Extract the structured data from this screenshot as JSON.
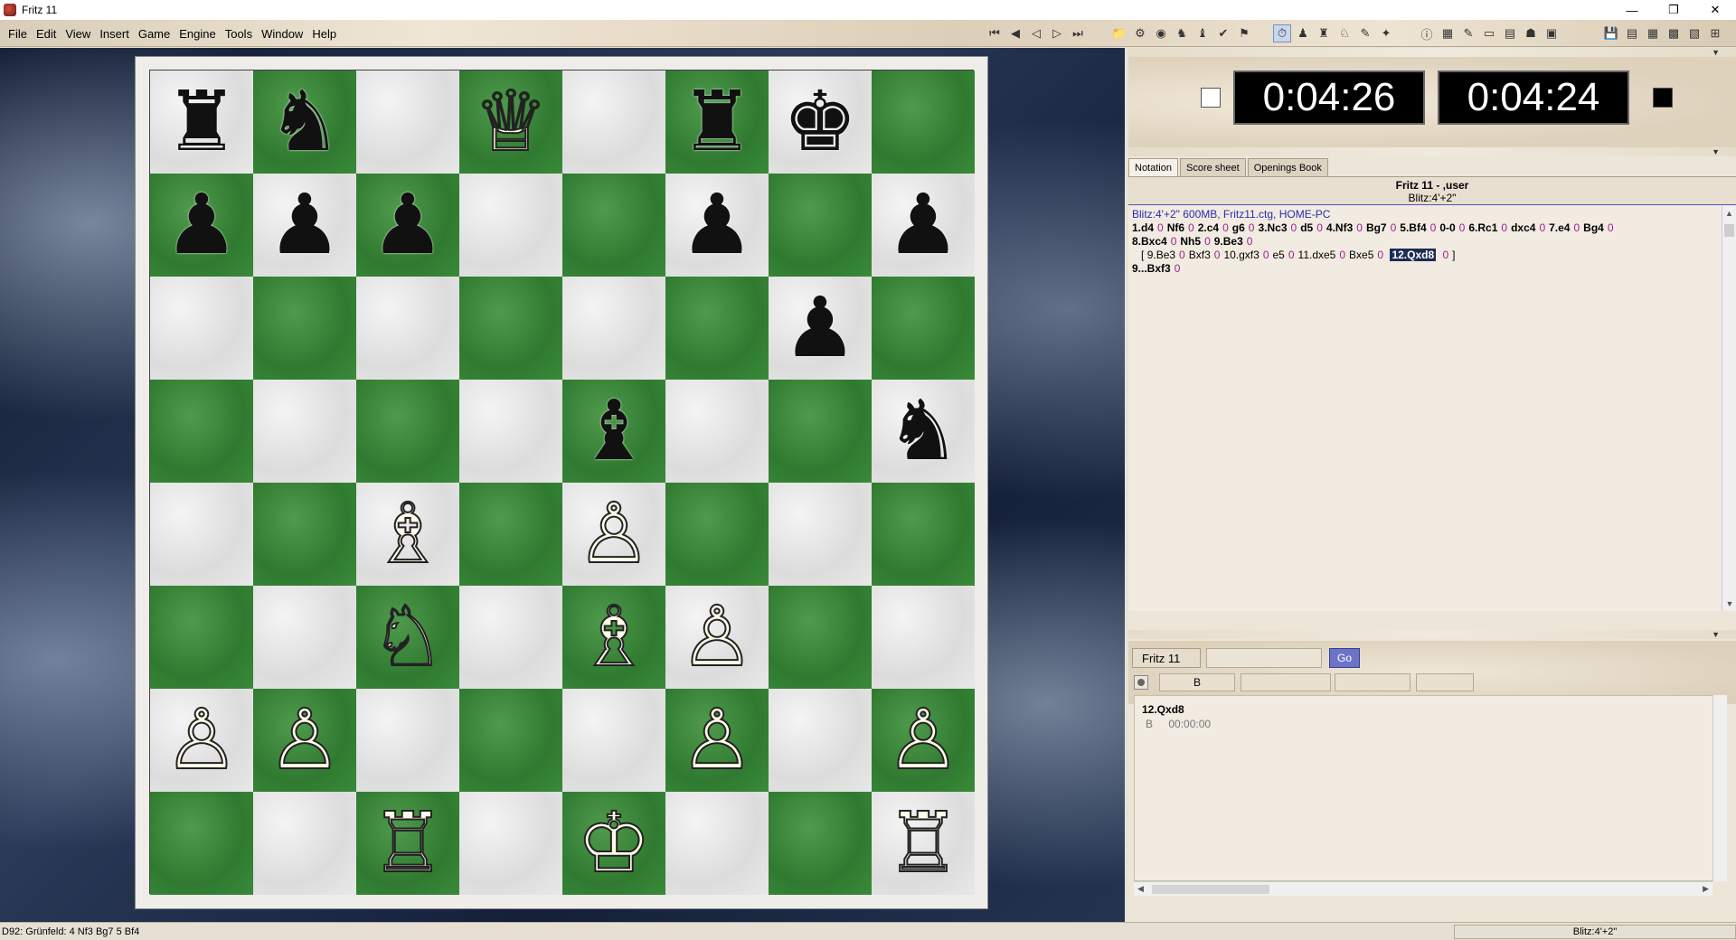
{
  "window": {
    "title": "Fritz 11",
    "minimize": "—",
    "restore": "❐",
    "close": "✕"
  },
  "menu": [
    "File",
    "Edit",
    "View",
    "Insert",
    "Game",
    "Engine",
    "Tools",
    "Window",
    "Help"
  ],
  "toolbar": {
    "nav": [
      "⏮",
      "◀",
      "◁",
      "▷",
      "⏭"
    ],
    "group2": [
      "📁",
      "⚙",
      "◉",
      "♞",
      "♝",
      "✔",
      "⚑"
    ],
    "group3": [
      "⏱",
      "♟",
      "♜",
      "♘",
      "✎",
      "✦"
    ],
    "group4": [
      "ⓘ",
      "▦",
      "✎",
      "▭",
      "▤",
      "☗",
      "▣"
    ],
    "group5": [
      "💾",
      "▤",
      "▦",
      "▩",
      "▧",
      "⊞"
    ]
  },
  "board": {
    "ranks": [
      [
        {
          "p": "♜",
          "c": "b"
        },
        {
          "p": "♞",
          "c": "b"
        },
        null,
        {
          "p": "♕",
          "c": "w"
        },
        null,
        {
          "p": "♜",
          "c": "b"
        },
        {
          "p": "♚",
          "c": "b"
        },
        null
      ],
      [
        {
          "p": "♟",
          "c": "b"
        },
        {
          "p": "♟",
          "c": "b"
        },
        {
          "p": "♟",
          "c": "b"
        },
        null,
        null,
        {
          "p": "♟",
          "c": "b"
        },
        null,
        {
          "p": "♟",
          "c": "b"
        }
      ],
      [
        null,
        null,
        null,
        null,
        null,
        null,
        {
          "p": "♟",
          "c": "b"
        },
        null
      ],
      [
        null,
        null,
        null,
        null,
        {
          "p": "♝",
          "c": "b"
        },
        null,
        null,
        {
          "p": "♞",
          "c": "b"
        }
      ],
      [
        null,
        null,
        {
          "p": "♗",
          "c": "w"
        },
        null,
        {
          "p": "♙",
          "c": "w"
        },
        null,
        null,
        null
      ],
      [
        null,
        null,
        {
          "p": "♘",
          "c": "w"
        },
        null,
        {
          "p": "♗",
          "c": "w"
        },
        {
          "p": "♙",
          "c": "w"
        },
        null,
        null
      ],
      [
        {
          "p": "♙",
          "c": "w"
        },
        {
          "p": "♙",
          "c": "w"
        },
        null,
        null,
        null,
        {
          "p": "♙",
          "c": "w"
        },
        null,
        {
          "p": "♙",
          "c": "w"
        }
      ],
      [
        null,
        null,
        {
          "p": "♖",
          "c": "w"
        },
        null,
        {
          "p": "♔",
          "c": "w"
        },
        null,
        null,
        {
          "p": "♖",
          "c": "w"
        }
      ]
    ]
  },
  "clocks": {
    "white": "0:04:26",
    "black": "0:04:24"
  },
  "tabs": [
    "Notation",
    "Score sheet",
    "Openings Book"
  ],
  "notation": {
    "players": "Fritz 11 - ,user",
    "timecontrol": "Blitz:4'+2\"",
    "info": "Blitz:4'+2\"  600MB, Fritz11.ctg, HOME-PC",
    "line1": [
      [
        "1.d4",
        "0"
      ],
      [
        "Nf6",
        "0"
      ],
      [
        "2.c4",
        "0"
      ],
      [
        "g6",
        "0"
      ],
      [
        "3.Nc3",
        "0"
      ],
      [
        "d5",
        "0"
      ],
      [
        "4.Nf3",
        "0"
      ],
      [
        "Bg7",
        "0"
      ],
      [
        "5.Bf4",
        "0"
      ],
      [
        "0-0",
        "0"
      ],
      [
        "6.Rc1",
        "0"
      ],
      [
        "dxc4",
        "0"
      ],
      [
        "7.e4",
        "0"
      ],
      [
        "Bg4",
        "0"
      ]
    ],
    "line2": [
      [
        "8.Bxc4",
        "0"
      ],
      [
        "Nh5",
        "0"
      ],
      [
        "9.Be3",
        "0"
      ]
    ],
    "variation_open": "[",
    "variation": [
      [
        "9.Be3",
        "0"
      ],
      [
        "Bxf3",
        "0"
      ],
      [
        "10.gxf3",
        "0"
      ],
      [
        "e5",
        "0"
      ],
      [
        "11.dxe5",
        "0"
      ],
      [
        "Bxe5",
        "0"
      ]
    ],
    "variation_selected": "12.Qxd8",
    "variation_selected_eval": "0",
    "variation_close": "]",
    "line3": [
      [
        "9...Bxf3",
        "0"
      ]
    ]
  },
  "engine": {
    "name": "Fritz 11",
    "go_label": "Go",
    "cell1": "B",
    "analysis_move": "12.Qxd8",
    "analysis_side": "B",
    "analysis_time": "00:00:00"
  },
  "status": {
    "opening": "D92: Grünfeld: 4 Nf3 Bg7 5 Bf4",
    "right": "Blitz:4'+2\""
  }
}
